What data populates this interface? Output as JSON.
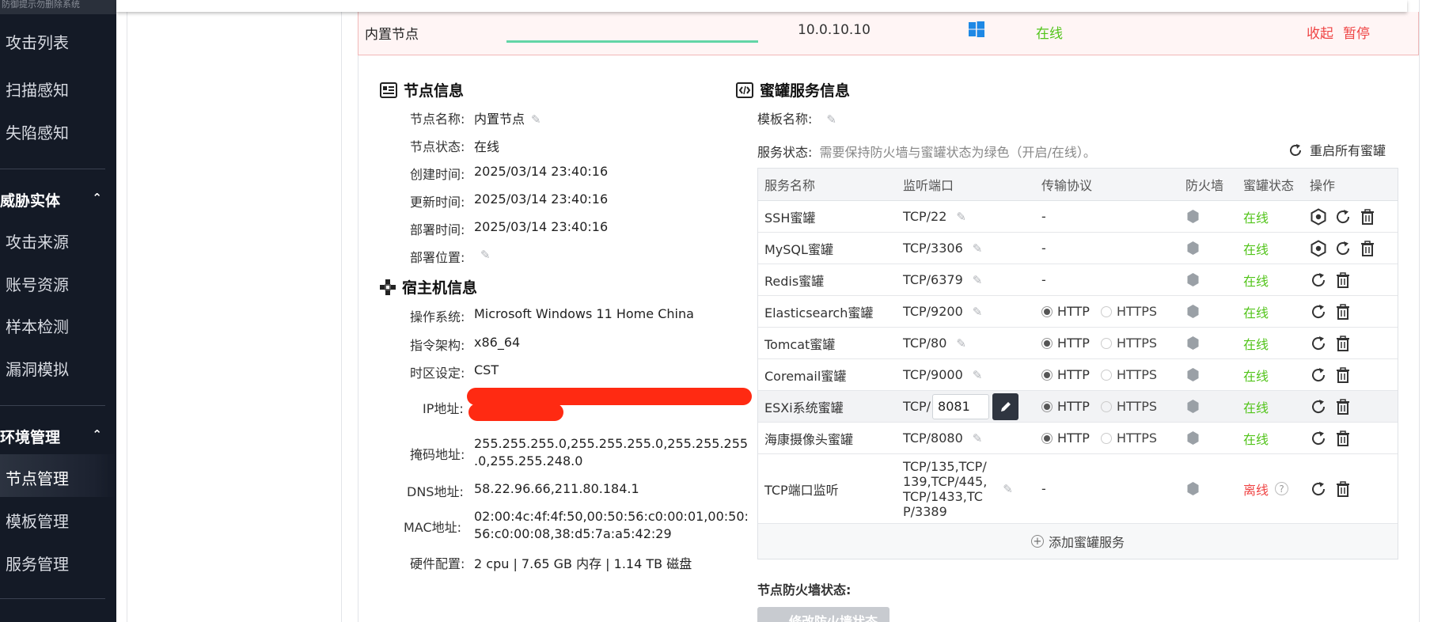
{
  "sidebar": {
    "top_text": "防御提示勿删除系统",
    "items": [
      {
        "label": "攻击列表"
      },
      {
        "label": "扫描感知"
      },
      {
        "label": "失陷感知"
      }
    ],
    "group_threat": {
      "label": "威胁实体",
      "items": [
        {
          "label": "攻击来源"
        },
        {
          "label": "账号资源"
        },
        {
          "label": "样本检测"
        },
        {
          "label": "漏洞模拟"
        }
      ]
    },
    "group_env": {
      "label": "环境管理",
      "items": [
        {
          "label": "节点管理"
        },
        {
          "label": "模板管理"
        },
        {
          "label": "服务管理"
        }
      ]
    }
  },
  "node_row": {
    "name": "内置节点",
    "ip": "10.0.10.10",
    "status": "在线",
    "action_collapse": "收起",
    "action_pause": "暂停"
  },
  "node_info": {
    "title": "节点信息",
    "fields": [
      {
        "label": "节点名称:",
        "value": "内置节点"
      },
      {
        "label": "节点状态:",
        "value": "在线"
      },
      {
        "label": "创建时间:",
        "value": "2025/03/14 23:40:16"
      },
      {
        "label": "更新时间:",
        "value": "2025/03/14 23:40:16"
      },
      {
        "label": "部署时间:",
        "value": "2025/03/14 23:40:16"
      },
      {
        "label": "部署位置:",
        "value": ""
      }
    ]
  },
  "host_info": {
    "title": "宿主机信息",
    "fields": [
      {
        "label": "操作系统:",
        "value": "Microsoft Windows 11 Home China"
      },
      {
        "label": "指令架构:",
        "value": "x86_64"
      },
      {
        "label": "时区设定:",
        "value": "CST"
      },
      {
        "label": "IP地址:",
        "value": ""
      },
      {
        "label": "掩码地址:",
        "value": "255.255.255.0,255.255.255.0,255.255.255",
        "value2": ".0,255.255.248.0"
      },
      {
        "label": "DNS地址:",
        "value": "58.22.96.66,211.80.184.1"
      },
      {
        "label": "MAC地址:",
        "value": "02:00:4c:4f:4f:50,00:50:56:c0:00:01,00:50:",
        "value2": "56:c0:00:08,38:d5:7a:a5:42:29"
      },
      {
        "label": "硬件配置:",
        "value": "2 cpu | 7.65 GB 内存 | 1.14 TB 磁盘"
      }
    ]
  },
  "honeypot": {
    "title": "蜜罐服务信息",
    "template_label": "模板名称:",
    "status_label": "服务状态:",
    "status_hint": "需要保持防火墙与蜜罐状态为绿色（开启/在线）。",
    "restart_all": "重启所有蜜罐",
    "columns": [
      "服务名称",
      "监听端口",
      "传输协议",
      "防火墙",
      "蜜罐状态",
      "操作"
    ],
    "rows": [
      {
        "name": "SSH蜜罐",
        "port": "TCP/22",
        "proto": "-",
        "status": "在线"
      },
      {
        "name": "MySQL蜜罐",
        "port": "TCP/3306",
        "proto": "-",
        "status": "在线"
      },
      {
        "name": "Redis蜜罐",
        "port": "TCP/6379",
        "proto": "-",
        "status": "在线"
      },
      {
        "name": "Elasticsearch蜜罐",
        "port": "TCP/9200",
        "proto_a": "HTTP",
        "proto_b": "HTTPS",
        "status": "在线"
      },
      {
        "name": "Tomcat蜜罐",
        "port": "TCP/80",
        "proto_a": "HTTP",
        "proto_b": "HTTPS",
        "status": "在线"
      },
      {
        "name": "Coremail蜜罐",
        "port": "TCP/9000",
        "proto_a": "HTTP",
        "proto_b": "HTTPS",
        "status": "在线"
      },
      {
        "name": "ESXi系统蜜罐",
        "port_prefix": "TCP/",
        "port_input": "8081",
        "proto_a": "HTTP",
        "proto_b": "HTTPS",
        "status": "在线"
      },
      {
        "name": "海康摄像头蜜罐",
        "port": "TCP/8080",
        "proto_a": "HTTP",
        "proto_b": "HTTPS",
        "status": "在线"
      },
      {
        "name": "TCP端口监听",
        "port_lines": [
          "TCP/135,TCP/",
          "139,TCP/445,",
          "TCP/1433,TC",
          "P/3389"
        ],
        "proto": "-",
        "status": "离线"
      }
    ],
    "add_service": "添加蜜罐服务",
    "firewall_label": "节点防火墙状态:",
    "firewall_button": "修改防火墙状态"
  },
  "colors": {
    "online": "#52c41a",
    "offline": "#ef4444",
    "sidebar_bg": "#141a26"
  }
}
